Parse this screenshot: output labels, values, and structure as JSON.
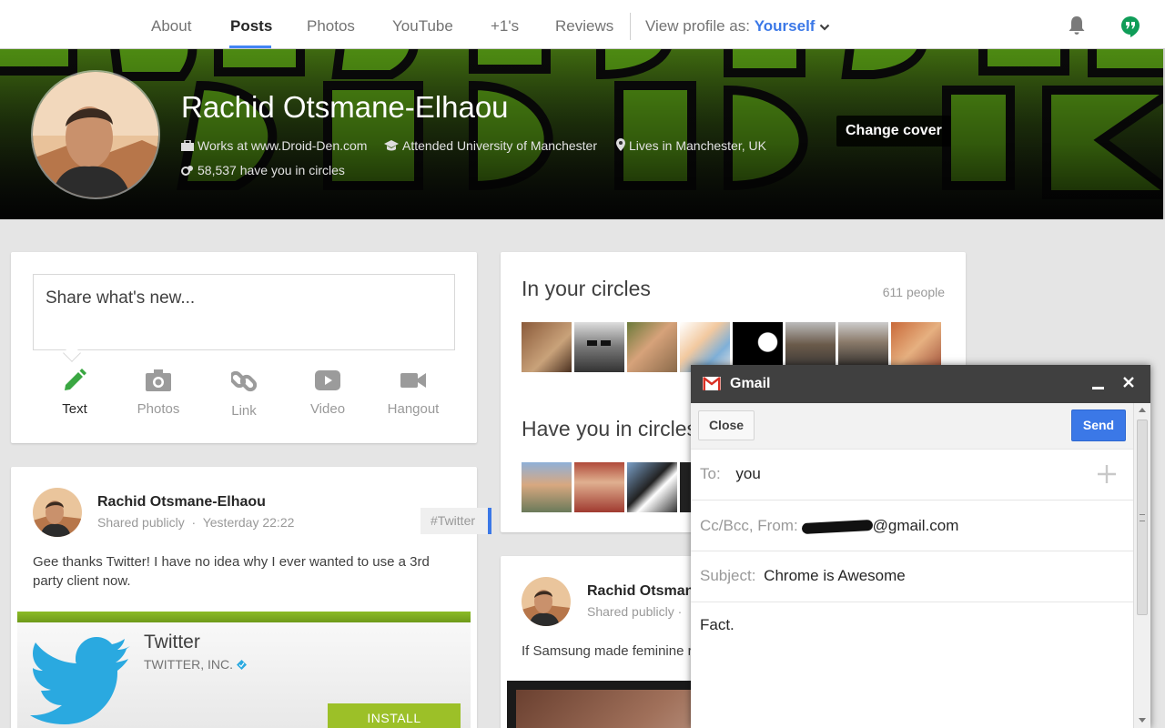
{
  "nav": {
    "tabs": [
      {
        "label": "About"
      },
      {
        "label": "Posts"
      },
      {
        "label": "Photos"
      },
      {
        "label": "YouTube"
      },
      {
        "label": "+1's"
      },
      {
        "label": "Reviews"
      }
    ],
    "view_profile_label": "View profile as:",
    "view_profile_value": "Yourself"
  },
  "profile": {
    "name": "Rachid Otsmane-Elhaou",
    "work": "Works at www.Droid-Den.com",
    "education": "Attended University of Manchester",
    "location": "Lives in Manchester, UK",
    "circled_by": "58,537 have you in circles",
    "change_cover_label": "Change cover"
  },
  "share": {
    "placeholder": "Share what's new...",
    "options": [
      {
        "label": "Text"
      },
      {
        "label": "Photos"
      },
      {
        "label": "Link"
      },
      {
        "label": "Video"
      },
      {
        "label": "Hangout"
      }
    ]
  },
  "circles": {
    "in_your_circles_title": "In your circles",
    "in_your_circles_count": "611 people",
    "have_you_title": "Have you in circles"
  },
  "post1": {
    "author": "Rachid Otsmane-Elhaou",
    "visibility": "Shared publicly",
    "time": "Yesterday 22:22",
    "hashtag": "#Twitter",
    "text": "Gee thanks Twitter! I have no idea why I ever wanted to use a 3rd party client now.",
    "app_name": "Twitter",
    "app_developer": "TWITTER, INC.",
    "install_label": "INSTALL"
  },
  "post2": {
    "author": "Rachid Otsmane",
    "visibility": "Shared publicly  ·",
    "text": "If Samsung made feminine r"
  },
  "gmail": {
    "title": "Gmail",
    "close_label": "Close",
    "send_label": "Send",
    "to_label": "To:",
    "to_value": "you",
    "ccbcc_label": "Cc/Bcc, From:",
    "from_value": "@gmail.com",
    "subject_label": "Subject:",
    "subject_value": "Chrome is Awesome",
    "body": "Fact."
  },
  "colors": {
    "accent_blue": "#3b78e7",
    "nav_underline": "#4285f4",
    "hangouts_green": "#0f9d58",
    "share_text_green": "#3aa742",
    "install_green": "#9cc028",
    "gmail_header": "#404040"
  }
}
